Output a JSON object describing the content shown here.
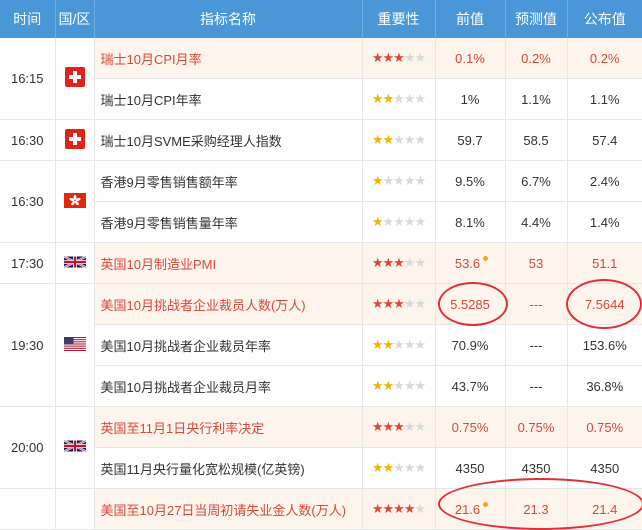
{
  "header": {
    "time": "时间",
    "region": "国/区",
    "indicator": "指标名称",
    "importance": "重要性",
    "previous": "前值",
    "forecast": "预测值",
    "actual": "公布值"
  },
  "groups": [
    {
      "time": "16:15",
      "flag": "swiss-flag-icon",
      "rows": [
        {
          "name": "瑞士10月CPI月率",
          "stars": 3,
          "hl": true,
          "prev": "0.1%",
          "fc": "0.2%",
          "act": "0.2%"
        },
        {
          "name": "瑞士10月CPI年率",
          "stars": 2,
          "hl": false,
          "prev": "1%",
          "fc": "1.1%",
          "act": "1.1%"
        }
      ]
    },
    {
      "time": "16:30",
      "flag": "swiss-flag-icon",
      "rows": [
        {
          "name": "瑞士10月SVME采购经理人指数",
          "stars": 2,
          "hl": false,
          "prev": "59.7",
          "fc": "58.5",
          "act": "57.4"
        }
      ]
    },
    {
      "time": "16:30",
      "flag": "hongkong-flag-icon",
      "rows": [
        {
          "name": "香港9月零售销售额年率",
          "stars": 1,
          "hl": false,
          "prev": "9.5%",
          "fc": "6.7%",
          "act": "2.4%"
        },
        {
          "name": "香港9月零售销售量年率",
          "stars": 1,
          "hl": false,
          "prev": "8.1%",
          "fc": "4.4%",
          "act": "1.4%"
        }
      ]
    },
    {
      "time": "17:30",
      "flag": "uk-flag-icon",
      "rows": [
        {
          "name": "英国10月制造业PMI",
          "stars": 3,
          "hl": true,
          "prev": "53.6",
          "prevDot": true,
          "fc": "53",
          "act": "51.1"
        }
      ]
    },
    {
      "time": "19:30",
      "flag": "us-flag-icon",
      "rows": [
        {
          "name": "美国10月挑战者企业裁员人数(万人)",
          "stars": 3,
          "hl": true,
          "prev": "5.5285",
          "fc": "---",
          "act": "7.5644"
        },
        {
          "name": "美国10月挑战者企业裁员年率",
          "stars": 2,
          "hl": false,
          "prev": "70.9%",
          "fc": "---",
          "act": "153.6%"
        },
        {
          "name": "美国10月挑战者企业裁员月率",
          "stars": 2,
          "hl": false,
          "prev": "43.7%",
          "fc": "---",
          "act": "36.8%"
        }
      ]
    },
    {
      "time": "20:00",
      "flag": "uk-flag-icon",
      "rows": [
        {
          "name": "英国至11月1日央行利率决定",
          "stars": 3,
          "hl": true,
          "prev": "0.75%",
          "fc": "0.75%",
          "act": "0.75%"
        },
        {
          "name": "英国11月央行量化宽松规模(亿英镑)",
          "stars": 2,
          "hl": false,
          "prev": "4350",
          "fc": "4350",
          "act": "4350"
        }
      ]
    },
    {
      "time": "",
      "flag": "",
      "rows": [
        {
          "name": "美国至10月27日当周初请失业金人数(万人)",
          "stars": 4,
          "hl": true,
          "prev": "21.6",
          "prevDot": true,
          "fc": "21.3",
          "act": "21.4"
        }
      ]
    }
  ]
}
